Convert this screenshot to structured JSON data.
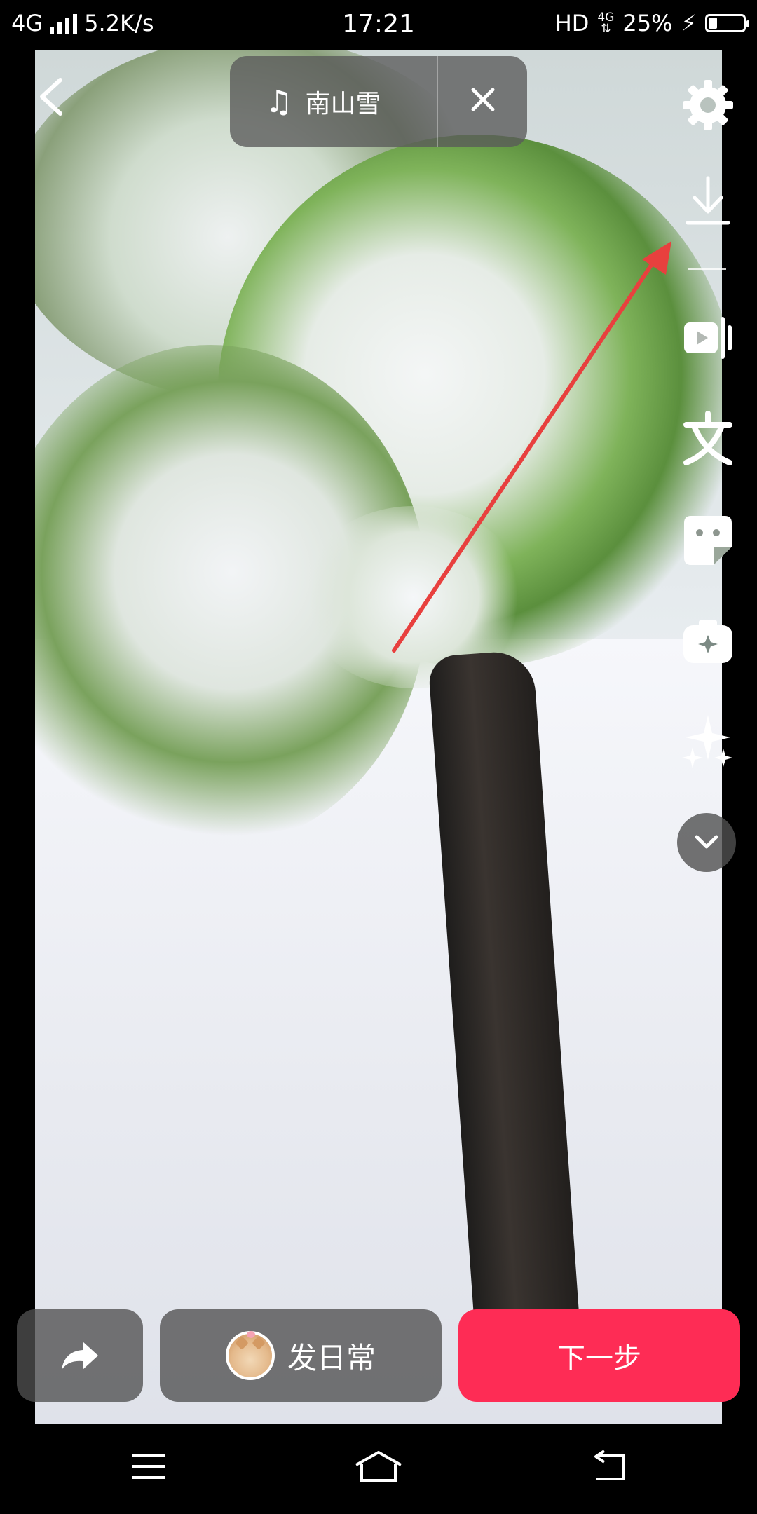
{
  "status_bar": {
    "network_type": "4G",
    "speed": "5.2K/s",
    "time": "17:21",
    "hd": "HD",
    "net_small_top": "4G",
    "battery_percent": "25%",
    "battery_level": 0.25
  },
  "top": {
    "music_title": "南山雪"
  },
  "toolbar": {
    "icons": [
      "gear-icon",
      "download-icon",
      "flip-icon",
      "text-icon",
      "sticker-icon",
      "effects-icon",
      "sparkle-icon",
      "chevron-down-icon"
    ]
  },
  "bottom": {
    "daily_label": "发日常",
    "next_label": "下一步"
  },
  "colors": {
    "accent": "#fe2c55",
    "annotation": "#e8403e"
  }
}
